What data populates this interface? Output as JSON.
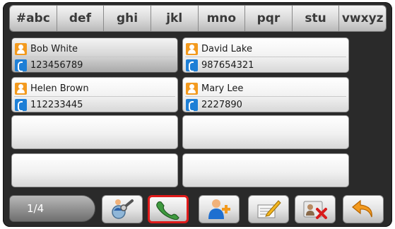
{
  "tabs": [
    "#abc",
    "def",
    "ghi",
    "jkl",
    "mno",
    "pqr",
    "stu",
    "vwxyz"
  ],
  "contacts": [
    {
      "name": "Bob White",
      "phone": "123456789",
      "selected": true
    },
    {
      "name": "David Lake",
      "phone": "987654321",
      "selected": false
    },
    {
      "name": "Helen Brown",
      "phone": "112233445",
      "selected": false
    },
    {
      "name": "Mary Lee",
      "phone": "2227890",
      "selected": false
    },
    {
      "name": "",
      "phone": "",
      "selected": false
    },
    {
      "name": "",
      "phone": "",
      "selected": false
    },
    {
      "name": "",
      "phone": "",
      "selected": false
    },
    {
      "name": "",
      "phone": "",
      "selected": false
    }
  ],
  "pager": {
    "label": "1/4"
  },
  "toolbar": {
    "buttons": [
      {
        "icon": "search-contact-icon"
      },
      {
        "icon": "phone-call-icon",
        "highlighted": true
      },
      {
        "icon": "add-contact-icon"
      },
      {
        "icon": "edit-icon"
      },
      {
        "icon": "delete-contact-icon"
      },
      {
        "icon": "back-arrow-icon"
      }
    ]
  },
  "colors": {
    "highlight": "#e01b1b",
    "person_icon": "#f39a1e",
    "phone_icon": "#1e7fd6",
    "frame": "#2a2a2a"
  }
}
